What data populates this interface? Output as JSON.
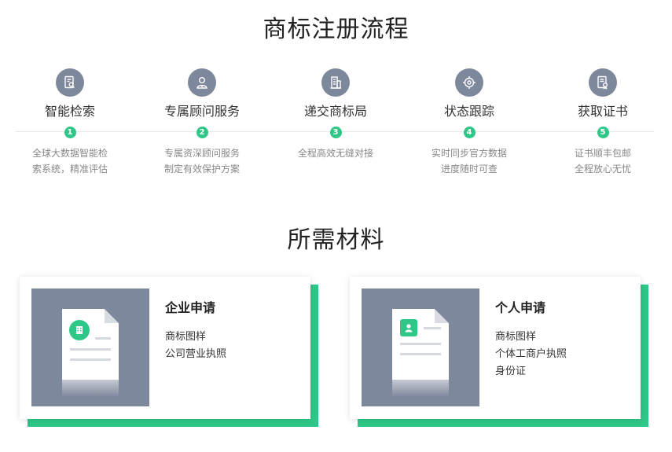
{
  "process": {
    "title": "商标注册流程",
    "steps": [
      {
        "name": "智能检索",
        "num": "1",
        "desc": [
          "全球大数据智能检",
          "索系统，精准评估"
        ],
        "icon": "search-document-icon"
      },
      {
        "name": "专属顾问服务",
        "num": "2",
        "desc": [
          "专属资深顾问服务",
          "制定有效保护方案"
        ],
        "icon": "consultant-icon"
      },
      {
        "name": "递交商标局",
        "num": "3",
        "desc": [
          "全程高效无缝对接"
        ],
        "icon": "building-icon"
      },
      {
        "name": "状态跟踪",
        "num": "4",
        "desc": [
          "实时同步官方数据",
          "进度随时可查"
        ],
        "icon": "target-icon"
      },
      {
        "name": "获取证书",
        "num": "5",
        "desc": [
          "证书顺丰包邮",
          "全程放心无忧"
        ],
        "icon": "certificate-icon"
      }
    ]
  },
  "materials": {
    "title": "所需材料",
    "cards": [
      {
        "title": "企业申请",
        "items": [
          "商标图样",
          "公司营业执照"
        ],
        "icon": "company-icon"
      },
      {
        "title": "个人申请",
        "items": [
          "商标图样",
          "个体工商户执照",
          "身份证"
        ],
        "icon": "person-id-icon"
      }
    ]
  },
  "colors": {
    "accent": "#2fc787",
    "icon_bg": "#7e889c",
    "text": "#333333",
    "muted": "#888888"
  }
}
